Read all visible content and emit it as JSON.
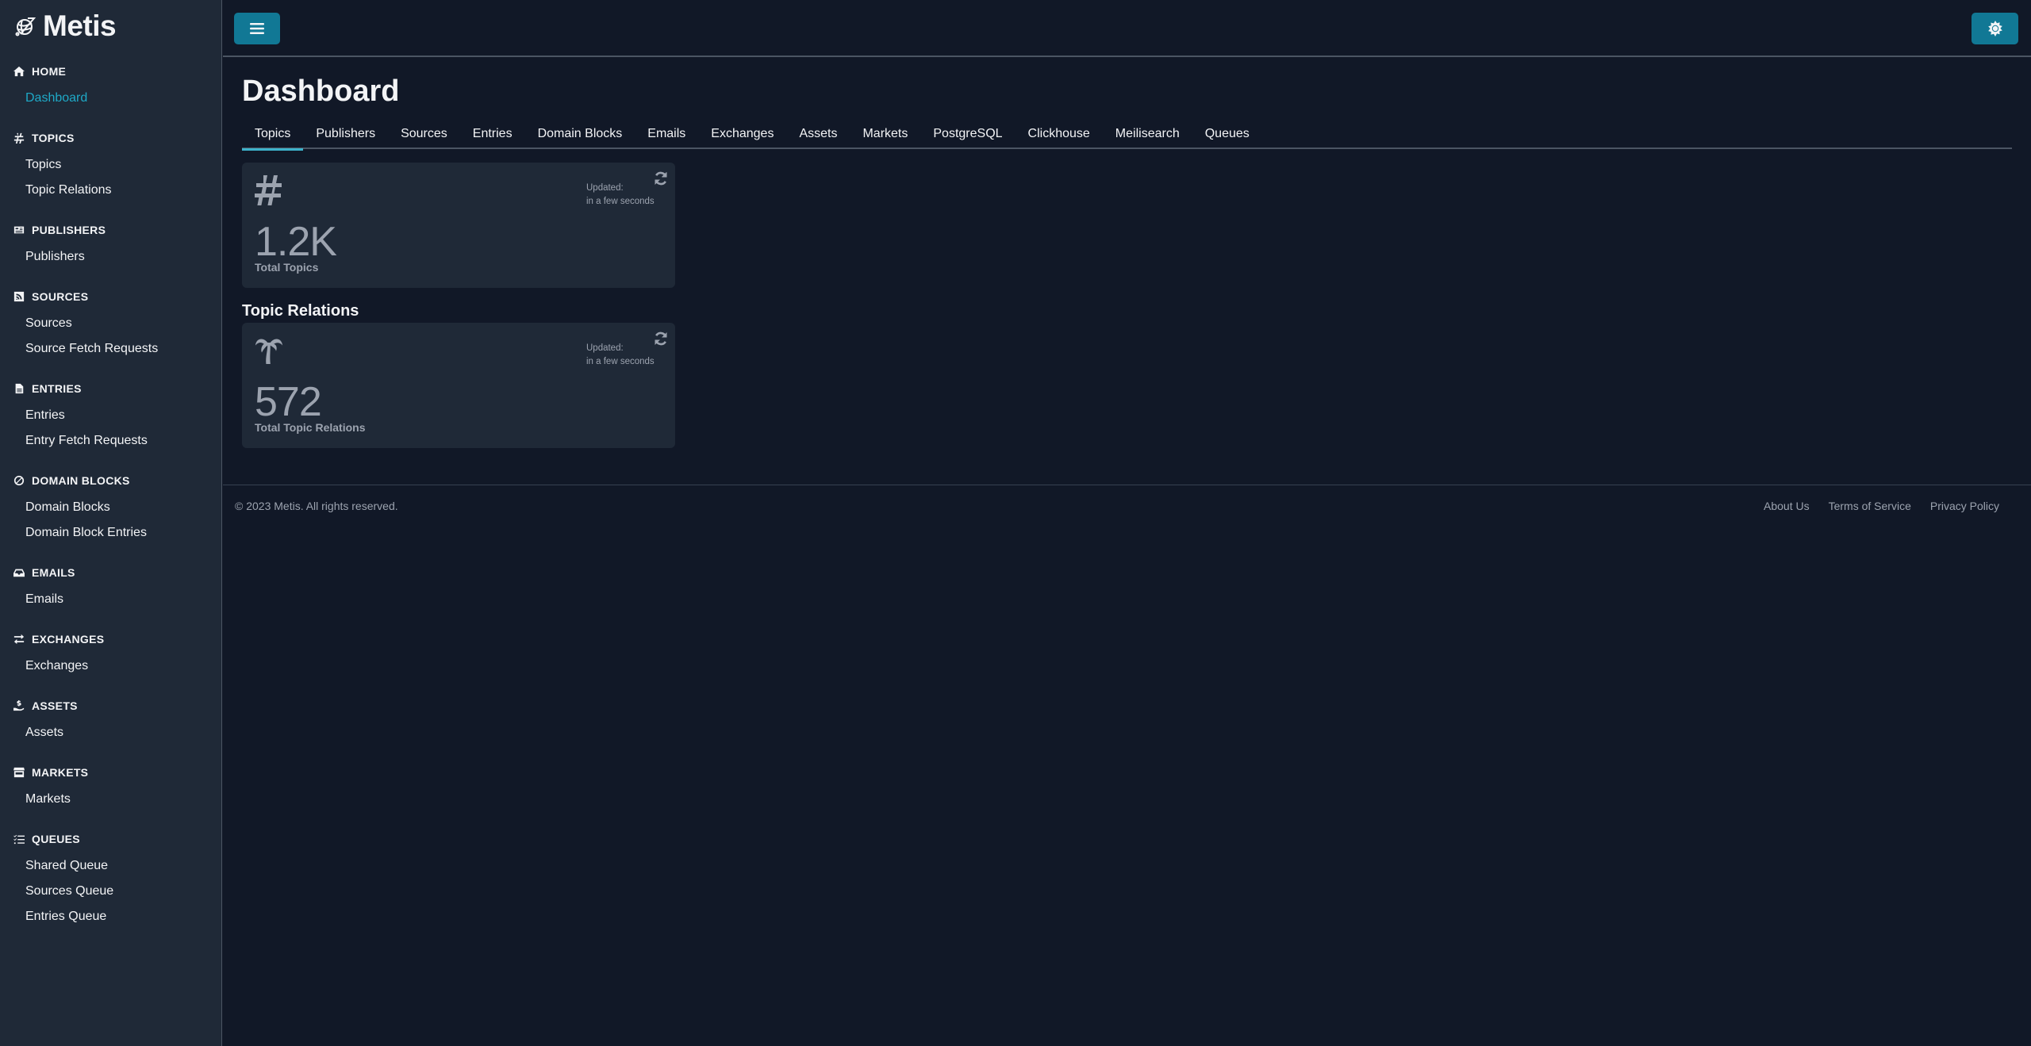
{
  "app": {
    "name": "Metis"
  },
  "sidebar": {
    "groups": [
      {
        "title": "HOME",
        "icon": "home-icon",
        "items": [
          {
            "label": "Dashboard",
            "active": true
          }
        ]
      },
      {
        "title": "TOPICS",
        "icon": "hashtag-icon",
        "items": [
          {
            "label": "Topics"
          },
          {
            "label": "Topic Relations"
          }
        ]
      },
      {
        "title": "PUBLISHERS",
        "icon": "newspaper-icon",
        "items": [
          {
            "label": "Publishers"
          }
        ]
      },
      {
        "title": "SOURCES",
        "icon": "rss-icon",
        "items": [
          {
            "label": "Sources"
          },
          {
            "label": "Source Fetch Requests"
          }
        ]
      },
      {
        "title": "ENTRIES",
        "icon": "file-icon",
        "items": [
          {
            "label": "Entries"
          },
          {
            "label": "Entry Fetch Requests"
          }
        ]
      },
      {
        "title": "DOMAIN BLOCKS",
        "icon": "ban-icon",
        "items": [
          {
            "label": "Domain Blocks"
          },
          {
            "label": "Domain Block Entries"
          }
        ]
      },
      {
        "title": "EMAILS",
        "icon": "inbox-icon",
        "items": [
          {
            "label": "Emails"
          }
        ]
      },
      {
        "title": "EXCHANGES",
        "icon": "exchange-icon",
        "items": [
          {
            "label": "Exchanges"
          }
        ]
      },
      {
        "title": "ASSETS",
        "icon": "hand-holding-dollar-icon",
        "items": [
          {
            "label": "Assets"
          }
        ]
      },
      {
        "title": "MARKETS",
        "icon": "store-icon",
        "items": [
          {
            "label": "Markets"
          }
        ]
      },
      {
        "title": "QUEUES",
        "icon": "list-check-icon",
        "items": [
          {
            "label": "Shared Queue"
          },
          {
            "label": "Sources Queue"
          },
          {
            "label": "Entries Queue"
          }
        ]
      }
    ]
  },
  "topbar": {
    "menu_icon": "bars-icon",
    "theme_icon": "sun-icon"
  },
  "main": {
    "title": "Dashboard",
    "tabs": [
      {
        "label": "Topics",
        "active": true
      },
      {
        "label": "Publishers"
      },
      {
        "label": "Sources"
      },
      {
        "label": "Entries"
      },
      {
        "label": "Domain Blocks"
      },
      {
        "label": "Emails"
      },
      {
        "label": "Exchanges"
      },
      {
        "label": "Assets"
      },
      {
        "label": "Markets"
      },
      {
        "label": "PostgreSQL"
      },
      {
        "label": "Clickhouse"
      },
      {
        "label": "Meilisearch"
      },
      {
        "label": "Queues"
      }
    ],
    "cards": [
      {
        "icon": "hashtag-icon",
        "value": "1.2K",
        "label": "Total Topics",
        "updated_label": "Updated:",
        "updated_value": "in a few seconds"
      },
      {
        "section_title": "Topic Relations",
        "icon": "tree-palm-icon",
        "value": "572",
        "label": "Total Topic Relations",
        "updated_label": "Updated:",
        "updated_value": "in a few seconds"
      }
    ]
  },
  "footer": {
    "copyright": "© 2023 Metis. All rights reserved.",
    "links": [
      "About Us",
      "Terms of Service",
      "Privacy Policy"
    ]
  },
  "colors": {
    "accent": "#117895",
    "active_link": "#1fa9c7",
    "background": "#111827",
    "sidebar": "#1f2937"
  }
}
